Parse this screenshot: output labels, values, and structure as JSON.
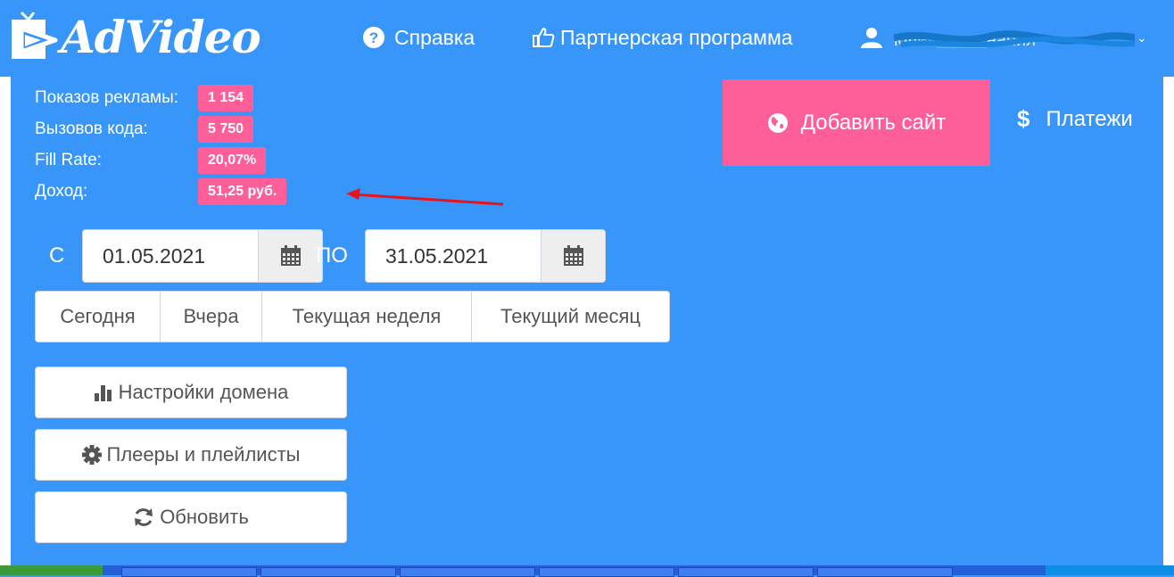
{
  "header": {
    "logo_text": "AdVideo",
    "help_label": "Справка",
    "partner_label": "Партнерская программа",
    "user_name": "юлия_____нания"
  },
  "stats": [
    {
      "label": "Показов рекламы:",
      "value": "1 154"
    },
    {
      "label": "Вызовов кода:",
      "value": "5 750"
    },
    {
      "label": "Fill Rate:",
      "value": "20,07%"
    },
    {
      "label": "Доход:",
      "value": "51,25 руб."
    }
  ],
  "add_site_label": "Добавить сайт",
  "payments_label": "Платежи",
  "payments_symbol": "$",
  "date_from_label": "С",
  "date_from": "01.05.2021",
  "date_to_label": "ПО",
  "date_to": "31.05.2021",
  "ranges": [
    "Сегодня",
    "Вчера",
    "Текущая неделя",
    "Текущий месяц"
  ],
  "actions": {
    "domain_settings": "Настройки домена",
    "players": "Плееры и плейлисты",
    "refresh": "Обновить"
  },
  "colors": {
    "background": "#3896fb",
    "accent_pink": "#ff5f98",
    "annotation_arrow": "#e8131b"
  }
}
